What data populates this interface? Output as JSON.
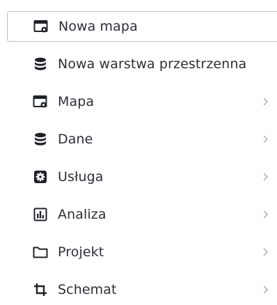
{
  "menu": {
    "items": [
      {
        "label": "Nowa mapa",
        "icon": "map-window-gear-icon",
        "selected": true,
        "submenu": false
      },
      {
        "label": "Nowa warstwa przestrzenna",
        "icon": "database-icon",
        "selected": false,
        "submenu": false
      },
      {
        "label": "Mapa",
        "icon": "map-window-gear-icon",
        "selected": false,
        "submenu": true
      },
      {
        "label": "Dane",
        "icon": "database-icon",
        "selected": false,
        "submenu": true
      },
      {
        "label": "Usługa",
        "icon": "gear-square-icon",
        "selected": false,
        "submenu": true
      },
      {
        "label": "Analiza",
        "icon": "bar-chart-icon",
        "selected": false,
        "submenu": true
      },
      {
        "label": "Projekt",
        "icon": "folder-icon",
        "selected": false,
        "submenu": true
      },
      {
        "label": "Schemat",
        "icon": "crop-icon",
        "selected": false,
        "submenu": true
      }
    ]
  },
  "colors": {
    "text": "#2b2f36",
    "icon": "#1f2329",
    "chevron": "#a7abb2",
    "selected_border": "#b9bec7"
  }
}
